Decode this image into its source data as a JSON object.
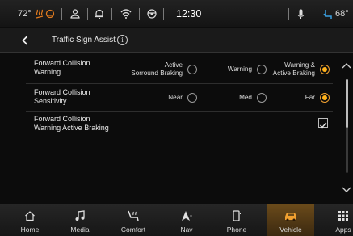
{
  "status_bar": {
    "temp_left": "72°",
    "clock": "12:30",
    "temp_right": "68°"
  },
  "header": {
    "title": "Traffic Sign Assist",
    "info_glyph": "i"
  },
  "settings": [
    {
      "label_line1": "Forward Collision",
      "label_line2": "Warning",
      "options": [
        {
          "line1": "Active",
          "line2": "Sorround Braking",
          "selected": false
        },
        {
          "line1": "",
          "line2": "Warning",
          "selected": false
        },
        {
          "line1": "Warning &",
          "line2": "Active Braking",
          "selected": true
        }
      ]
    },
    {
      "label_line1": "Forward Collision",
      "label_line2": "Sensitivity",
      "options": [
        {
          "line1": "",
          "line2": "Near",
          "selected": false
        },
        {
          "line1": "",
          "line2": "Med",
          "selected": false
        },
        {
          "line1": "",
          "line2": "Far",
          "selected": true
        }
      ]
    },
    {
      "label_line1": "Forward Collision",
      "label_line2": "Warning Active Braking",
      "checked": true
    }
  ],
  "nav": {
    "items": [
      {
        "label": "Home",
        "icon": "home-icon"
      },
      {
        "label": "Media",
        "icon": "music-note-icon"
      },
      {
        "label": "Comfort",
        "icon": "heated-seat-icon"
      },
      {
        "label": "Nav",
        "icon": "navigation-arrow-icon"
      },
      {
        "label": "Phone",
        "icon": "phone-icon"
      },
      {
        "label": "Vehicle",
        "icon": "car-icon"
      },
      {
        "label": "Apps",
        "icon": "apps-grid-icon"
      }
    ],
    "active": "Vehicle"
  },
  "colors": {
    "accent": "#ffb21a",
    "active_tab": "#6a4a1a",
    "background": "#0c0c0c"
  }
}
